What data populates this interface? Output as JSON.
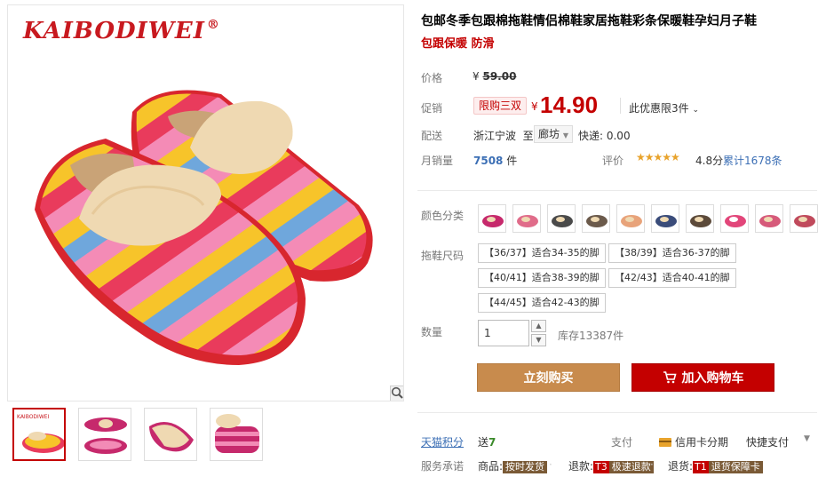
{
  "brand": {
    "logo_text": "KAIBODIWEI",
    "registered_mark": "®"
  },
  "product": {
    "title": "包邮冬季包跟棉拖鞋情侣棉鞋家居拖鞋彩条保暖鞋孕妇月子鞋",
    "subtitle": "包跟保暖 防滑"
  },
  "pricing": {
    "price_label": "价格",
    "currency": "¥",
    "original_price": "59.00",
    "promo_label": "促销",
    "promo_tag": "限购三双",
    "promo_price": "14.90",
    "promo_limit": "此优惠限3件",
    "delivery_label": "配送",
    "ship_from": "浙江宁波",
    "ship_to_prefix": "至",
    "ship_to": "廊坊",
    "shipping_fee": "快递: 0.00",
    "sales_label": "月销量",
    "monthly_sales": "7508",
    "sales_unit": "件",
    "rating_label": "评价",
    "stars": "★★★★★",
    "rating_score": "4.8分",
    "review_count": "累计1678条"
  },
  "options": {
    "color_label": "颜色分类",
    "color_swatch_count": 10,
    "size_label": "拖鞋尺码",
    "sizes": [
      "【36/37】适合34-35的脚",
      "【38/39】适合36-37的脚",
      "【40/41】适合38-39的脚",
      "【42/43】适合40-41的脚",
      "【44/45】适合42-43的脚"
    ],
    "quantity_label": "数量",
    "quantity_value": "1",
    "stock": "库存13387件"
  },
  "actions": {
    "buy_now": "立刻购买",
    "add_to_cart": "加入购物车"
  },
  "footer": {
    "points_label": "天猫积分",
    "points_value_prefix": "送",
    "points_value": "7",
    "payment_label": "支付",
    "payment_credit": "信用卡分期",
    "payment_quick": "快捷支付",
    "service_label": "服务承诺",
    "service_goods": "商品:",
    "service_goods_badge": "按时发货",
    "service_refund": "退款:",
    "service_refund_code": "T3",
    "service_refund_badge": "极速退款",
    "service_return": "退货:",
    "service_return_code": "T1",
    "service_return_badge": "退货保障卡"
  },
  "colors": {
    "accent_red": "#c40000",
    "buy_button": "#c88b4d",
    "link_blue": "#3c6fb5"
  },
  "icons": [
    "zoom-icon",
    "cart-icon",
    "credit-card-icon",
    "chevron-down-icon",
    "star-icon"
  ]
}
